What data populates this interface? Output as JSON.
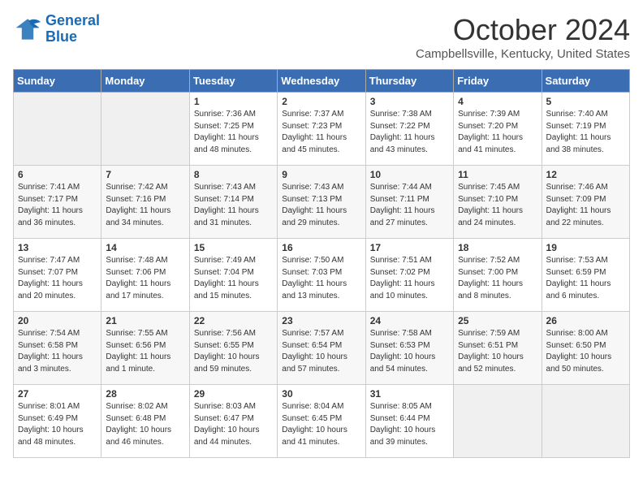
{
  "logo": {
    "line1": "General",
    "line2": "Blue"
  },
  "title": "October 2024",
  "location": "Campbellsville, Kentucky, United States",
  "days_of_week": [
    "Sunday",
    "Monday",
    "Tuesday",
    "Wednesday",
    "Thursday",
    "Friday",
    "Saturday"
  ],
  "weeks": [
    [
      {
        "day": "",
        "info": ""
      },
      {
        "day": "",
        "info": ""
      },
      {
        "day": "1",
        "info": "Sunrise: 7:36 AM\nSunset: 7:25 PM\nDaylight: 11 hours and 48 minutes."
      },
      {
        "day": "2",
        "info": "Sunrise: 7:37 AM\nSunset: 7:23 PM\nDaylight: 11 hours and 45 minutes."
      },
      {
        "day": "3",
        "info": "Sunrise: 7:38 AM\nSunset: 7:22 PM\nDaylight: 11 hours and 43 minutes."
      },
      {
        "day": "4",
        "info": "Sunrise: 7:39 AM\nSunset: 7:20 PM\nDaylight: 11 hours and 41 minutes."
      },
      {
        "day": "5",
        "info": "Sunrise: 7:40 AM\nSunset: 7:19 PM\nDaylight: 11 hours and 38 minutes."
      }
    ],
    [
      {
        "day": "6",
        "info": "Sunrise: 7:41 AM\nSunset: 7:17 PM\nDaylight: 11 hours and 36 minutes."
      },
      {
        "day": "7",
        "info": "Sunrise: 7:42 AM\nSunset: 7:16 PM\nDaylight: 11 hours and 34 minutes."
      },
      {
        "day": "8",
        "info": "Sunrise: 7:43 AM\nSunset: 7:14 PM\nDaylight: 11 hours and 31 minutes."
      },
      {
        "day": "9",
        "info": "Sunrise: 7:43 AM\nSunset: 7:13 PM\nDaylight: 11 hours and 29 minutes."
      },
      {
        "day": "10",
        "info": "Sunrise: 7:44 AM\nSunset: 7:11 PM\nDaylight: 11 hours and 27 minutes."
      },
      {
        "day": "11",
        "info": "Sunrise: 7:45 AM\nSunset: 7:10 PM\nDaylight: 11 hours and 24 minutes."
      },
      {
        "day": "12",
        "info": "Sunrise: 7:46 AM\nSunset: 7:09 PM\nDaylight: 11 hours and 22 minutes."
      }
    ],
    [
      {
        "day": "13",
        "info": "Sunrise: 7:47 AM\nSunset: 7:07 PM\nDaylight: 11 hours and 20 minutes."
      },
      {
        "day": "14",
        "info": "Sunrise: 7:48 AM\nSunset: 7:06 PM\nDaylight: 11 hours and 17 minutes."
      },
      {
        "day": "15",
        "info": "Sunrise: 7:49 AM\nSunset: 7:04 PM\nDaylight: 11 hours and 15 minutes."
      },
      {
        "day": "16",
        "info": "Sunrise: 7:50 AM\nSunset: 7:03 PM\nDaylight: 11 hours and 13 minutes."
      },
      {
        "day": "17",
        "info": "Sunrise: 7:51 AM\nSunset: 7:02 PM\nDaylight: 11 hours and 10 minutes."
      },
      {
        "day": "18",
        "info": "Sunrise: 7:52 AM\nSunset: 7:00 PM\nDaylight: 11 hours and 8 minutes."
      },
      {
        "day": "19",
        "info": "Sunrise: 7:53 AM\nSunset: 6:59 PM\nDaylight: 11 hours and 6 minutes."
      }
    ],
    [
      {
        "day": "20",
        "info": "Sunrise: 7:54 AM\nSunset: 6:58 PM\nDaylight: 11 hours and 3 minutes."
      },
      {
        "day": "21",
        "info": "Sunrise: 7:55 AM\nSunset: 6:56 PM\nDaylight: 11 hours and 1 minute."
      },
      {
        "day": "22",
        "info": "Sunrise: 7:56 AM\nSunset: 6:55 PM\nDaylight: 10 hours and 59 minutes."
      },
      {
        "day": "23",
        "info": "Sunrise: 7:57 AM\nSunset: 6:54 PM\nDaylight: 10 hours and 57 minutes."
      },
      {
        "day": "24",
        "info": "Sunrise: 7:58 AM\nSunset: 6:53 PM\nDaylight: 10 hours and 54 minutes."
      },
      {
        "day": "25",
        "info": "Sunrise: 7:59 AM\nSunset: 6:51 PM\nDaylight: 10 hours and 52 minutes."
      },
      {
        "day": "26",
        "info": "Sunrise: 8:00 AM\nSunset: 6:50 PM\nDaylight: 10 hours and 50 minutes."
      }
    ],
    [
      {
        "day": "27",
        "info": "Sunrise: 8:01 AM\nSunset: 6:49 PM\nDaylight: 10 hours and 48 minutes."
      },
      {
        "day": "28",
        "info": "Sunrise: 8:02 AM\nSunset: 6:48 PM\nDaylight: 10 hours and 46 minutes."
      },
      {
        "day": "29",
        "info": "Sunrise: 8:03 AM\nSunset: 6:47 PM\nDaylight: 10 hours and 44 minutes."
      },
      {
        "day": "30",
        "info": "Sunrise: 8:04 AM\nSunset: 6:45 PM\nDaylight: 10 hours and 41 minutes."
      },
      {
        "day": "31",
        "info": "Sunrise: 8:05 AM\nSunset: 6:44 PM\nDaylight: 10 hours and 39 minutes."
      },
      {
        "day": "",
        "info": ""
      },
      {
        "day": "",
        "info": ""
      }
    ]
  ]
}
